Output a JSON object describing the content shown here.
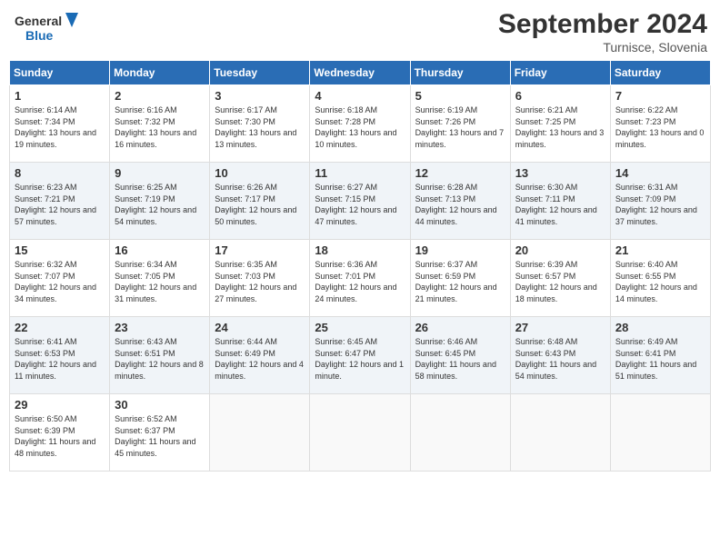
{
  "logo": {
    "line1": "General",
    "line2": "Blue"
  },
  "title": "September 2024",
  "subtitle": "Turnisce, Slovenia",
  "weekdays": [
    "Sunday",
    "Monday",
    "Tuesday",
    "Wednesday",
    "Thursday",
    "Friday",
    "Saturday"
  ],
  "weeks": [
    [
      {
        "day": "1",
        "sunrise": "6:14 AM",
        "sunset": "7:34 PM",
        "daylight": "13 hours and 19 minutes."
      },
      {
        "day": "2",
        "sunrise": "6:16 AM",
        "sunset": "7:32 PM",
        "daylight": "13 hours and 16 minutes."
      },
      {
        "day": "3",
        "sunrise": "6:17 AM",
        "sunset": "7:30 PM",
        "daylight": "13 hours and 13 minutes."
      },
      {
        "day": "4",
        "sunrise": "6:18 AM",
        "sunset": "7:28 PM",
        "daylight": "13 hours and 10 minutes."
      },
      {
        "day": "5",
        "sunrise": "6:19 AM",
        "sunset": "7:26 PM",
        "daylight": "13 hours and 7 minutes."
      },
      {
        "day": "6",
        "sunrise": "6:21 AM",
        "sunset": "7:25 PM",
        "daylight": "13 hours and 3 minutes."
      },
      {
        "day": "7",
        "sunrise": "6:22 AM",
        "sunset": "7:23 PM",
        "daylight": "13 hours and 0 minutes."
      }
    ],
    [
      {
        "day": "8",
        "sunrise": "6:23 AM",
        "sunset": "7:21 PM",
        "daylight": "12 hours and 57 minutes."
      },
      {
        "day": "9",
        "sunrise": "6:25 AM",
        "sunset": "7:19 PM",
        "daylight": "12 hours and 54 minutes."
      },
      {
        "day": "10",
        "sunrise": "6:26 AM",
        "sunset": "7:17 PM",
        "daylight": "12 hours and 50 minutes."
      },
      {
        "day": "11",
        "sunrise": "6:27 AM",
        "sunset": "7:15 PM",
        "daylight": "12 hours and 47 minutes."
      },
      {
        "day": "12",
        "sunrise": "6:28 AM",
        "sunset": "7:13 PM",
        "daylight": "12 hours and 44 minutes."
      },
      {
        "day": "13",
        "sunrise": "6:30 AM",
        "sunset": "7:11 PM",
        "daylight": "12 hours and 41 minutes."
      },
      {
        "day": "14",
        "sunrise": "6:31 AM",
        "sunset": "7:09 PM",
        "daylight": "12 hours and 37 minutes."
      }
    ],
    [
      {
        "day": "15",
        "sunrise": "6:32 AM",
        "sunset": "7:07 PM",
        "daylight": "12 hours and 34 minutes."
      },
      {
        "day": "16",
        "sunrise": "6:34 AM",
        "sunset": "7:05 PM",
        "daylight": "12 hours and 31 minutes."
      },
      {
        "day": "17",
        "sunrise": "6:35 AM",
        "sunset": "7:03 PM",
        "daylight": "12 hours and 27 minutes."
      },
      {
        "day": "18",
        "sunrise": "6:36 AM",
        "sunset": "7:01 PM",
        "daylight": "12 hours and 24 minutes."
      },
      {
        "day": "19",
        "sunrise": "6:37 AM",
        "sunset": "6:59 PM",
        "daylight": "12 hours and 21 minutes."
      },
      {
        "day": "20",
        "sunrise": "6:39 AM",
        "sunset": "6:57 PM",
        "daylight": "12 hours and 18 minutes."
      },
      {
        "day": "21",
        "sunrise": "6:40 AM",
        "sunset": "6:55 PM",
        "daylight": "12 hours and 14 minutes."
      }
    ],
    [
      {
        "day": "22",
        "sunrise": "6:41 AM",
        "sunset": "6:53 PM",
        "daylight": "12 hours and 11 minutes."
      },
      {
        "day": "23",
        "sunrise": "6:43 AM",
        "sunset": "6:51 PM",
        "daylight": "12 hours and 8 minutes."
      },
      {
        "day": "24",
        "sunrise": "6:44 AM",
        "sunset": "6:49 PM",
        "daylight": "12 hours and 4 minutes."
      },
      {
        "day": "25",
        "sunrise": "6:45 AM",
        "sunset": "6:47 PM",
        "daylight": "12 hours and 1 minute."
      },
      {
        "day": "26",
        "sunrise": "6:46 AM",
        "sunset": "6:45 PM",
        "daylight": "11 hours and 58 minutes."
      },
      {
        "day": "27",
        "sunrise": "6:48 AM",
        "sunset": "6:43 PM",
        "daylight": "11 hours and 54 minutes."
      },
      {
        "day": "28",
        "sunrise": "6:49 AM",
        "sunset": "6:41 PM",
        "daylight": "11 hours and 51 minutes."
      }
    ],
    [
      {
        "day": "29",
        "sunrise": "6:50 AM",
        "sunset": "6:39 PM",
        "daylight": "11 hours and 48 minutes."
      },
      {
        "day": "30",
        "sunrise": "6:52 AM",
        "sunset": "6:37 PM",
        "daylight": "11 hours and 45 minutes."
      },
      null,
      null,
      null,
      null,
      null
    ]
  ]
}
